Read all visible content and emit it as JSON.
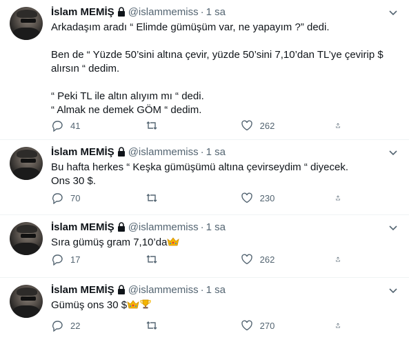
{
  "tweets": [
    {
      "author": "İslam MEMİŞ",
      "handle": "@islammemiss",
      "time": "1 sa",
      "text": "Arkadaşım aradı “ Elimde gümüşüm var, ne yapayım ?” dedi.\n\nBen de “ Yüzde 50’sini altına çevir, yüzde 50’sini 7,10’dan TL’ye çevirip $ alırsın “ dedim.\n\n“ Peki TL ile altın alıyım mı “ dedi.\n“ Almak ne demek GÖM “ dedim.",
      "reply_count": "41",
      "retweet_count": "",
      "like_count": "262"
    },
    {
      "author": "İslam MEMİŞ",
      "handle": "@islammemiss",
      "time": "1 sa",
      "text": "Bu hafta herkes “ Keşka gümüşümü altına çevirseydim “ diyecek.\nOns 30 $.",
      "reply_count": "70",
      "retweet_count": "",
      "like_count": "230"
    },
    {
      "author": "İslam MEMİŞ",
      "handle": "@islammemiss",
      "time": "1 sa",
      "text": "Sıra gümüş gram 7,10’da",
      "emojis": [
        "crown"
      ],
      "reply_count": "17",
      "retweet_count": "",
      "like_count": "262"
    },
    {
      "author": "İslam MEMİŞ",
      "handle": "@islammemiss",
      "time": "1 sa",
      "text": "Gümüş ons 30 $",
      "emojis": [
        "crown",
        "trophy"
      ],
      "reply_count": "22",
      "retweet_count": "",
      "like_count": "270"
    }
  ],
  "colors": {
    "text": "#0f1419",
    "secondary": "#536471",
    "divider": "#eff3f4"
  }
}
